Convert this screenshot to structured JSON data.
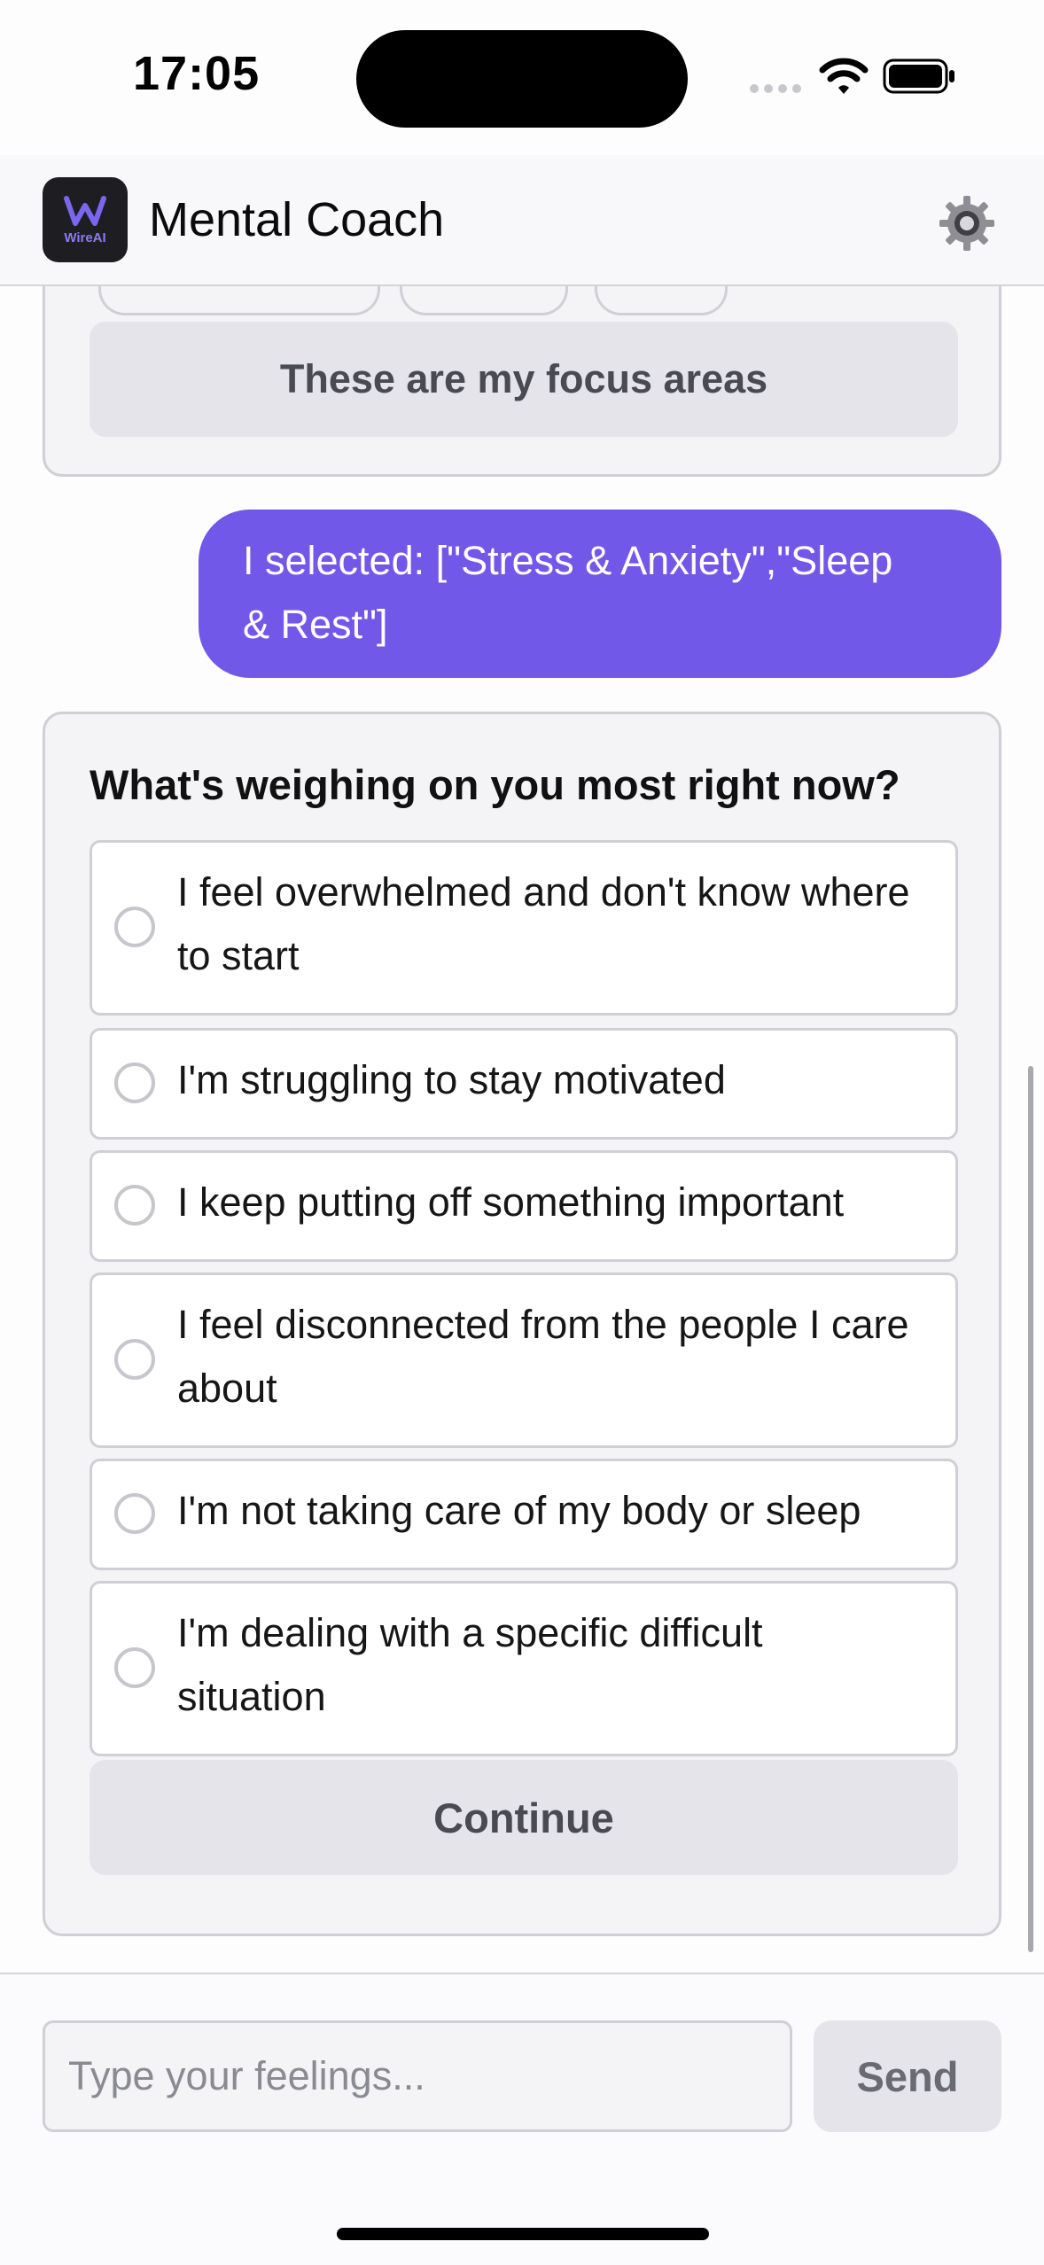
{
  "status_bar": {
    "time": "17:05",
    "icons": [
      "cellular-signal-icon",
      "wifi-icon",
      "battery-icon"
    ]
  },
  "header": {
    "logo_text": "WireAI",
    "title": "Mental Coach",
    "settings_icon": "gear-icon"
  },
  "chat": {
    "focus_card": {
      "button_label": "These are my focus areas"
    },
    "user_message": {
      "line1": "I selected: [\"Stress & Anxiety\",\"Sleep",
      "line2": "& Rest\"]"
    },
    "question_card": {
      "title": "What's weighing on you most right now?",
      "options": [
        {
          "line1": "I feel overwhelmed and don't know where",
          "line2": "to start",
          "selected": false
        },
        {
          "line1": "I'm struggling to stay motivated",
          "line2": "",
          "selected": false
        },
        {
          "line1": "I keep putting off something important",
          "line2": "",
          "selected": false
        },
        {
          "line1": "I feel disconnected from the people I care",
          "line2": "about",
          "selected": false
        },
        {
          "line1": "I'm not taking care of my body or sleep",
          "line2": "",
          "selected": false
        },
        {
          "line1": "I'm dealing with a specific difficult",
          "line2": "situation",
          "selected": false
        }
      ],
      "continue_label": "Continue"
    }
  },
  "composer": {
    "placeholder": "Type your feelings...",
    "value": "",
    "send_label": "Send"
  },
  "colors": {
    "accent": "#7258e9",
    "card_bg": "#f4f4f7",
    "button_bg": "#e4e4ea",
    "border": "#cfcfd6"
  }
}
